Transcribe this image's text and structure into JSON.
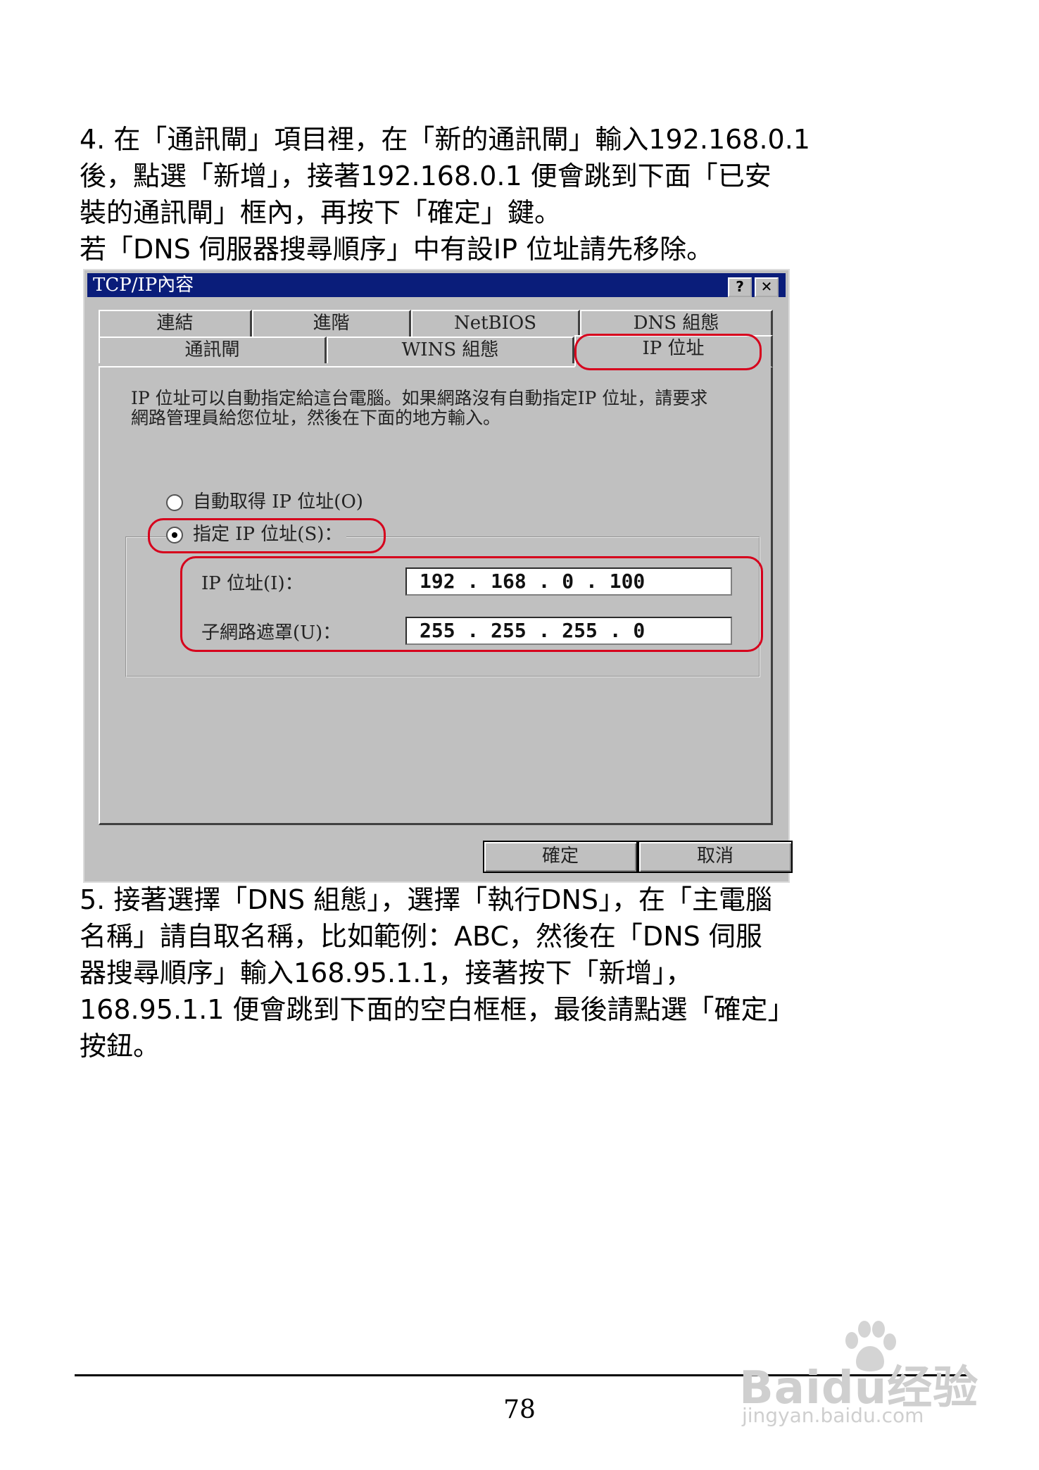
{
  "step4": {
    "lines": [
      "4. 在「通訊閘」項目裡，在「新的通訊閘」輸入192.168.0.1",
      "後，點選「新增」，接著192.168.0.1 便會跳到下面「已安",
      "裝的通訊閘」框內，再按下「確定」鍵。",
      "若「DNS 伺服器搜尋順序」中有設IP 位址請先移除。"
    ]
  },
  "dialog": {
    "title": "TCP/IP內容",
    "help_label": "?",
    "close_label": "✕",
    "tabs_row1": [
      "連結",
      "進階",
      "NetBIOS",
      "DNS 組態"
    ],
    "tabs_row2": [
      "通訊閘",
      "WINS 組態",
      "IP 位址"
    ],
    "description": "IP 位址可以自動指定給這台電腦。如果網路沒有自動指定IP 位址，請要求網路管理員給您位址，然後在下面的地方輸入。",
    "radio_auto": "自動取得 IP 位址(O)",
    "radio_manual": "指定 IP 位址(S)：",
    "ip_label": "IP 位址(I)：",
    "ip_value": "192 . 168 .  0  . 100",
    "subnet_label": "子網路遮罩(U)：",
    "subnet_value": "255 . 255 . 255 .  0",
    "ok_label": "確定",
    "cancel_label": "取消",
    "highlight_color": "#d6001c"
  },
  "step5": {
    "lines": [
      "5. 接著選擇「DNS 組態」，選擇「執行DNS」，在「主電腦",
      "名稱」請自取名稱，比如範例：ABC，然後在「DNS 伺服",
      "器搜尋順序」輸入168.95.1.1，接著按下「新增」，",
      "168.95.1.1 便會跳到下面的空白框框，最後請點選「確定」",
      "按鈕。"
    ]
  },
  "footer": {
    "page_number": "78"
  },
  "watermark": {
    "logo": "Baidu经验",
    "domain": "jingyan.baidu.com"
  }
}
